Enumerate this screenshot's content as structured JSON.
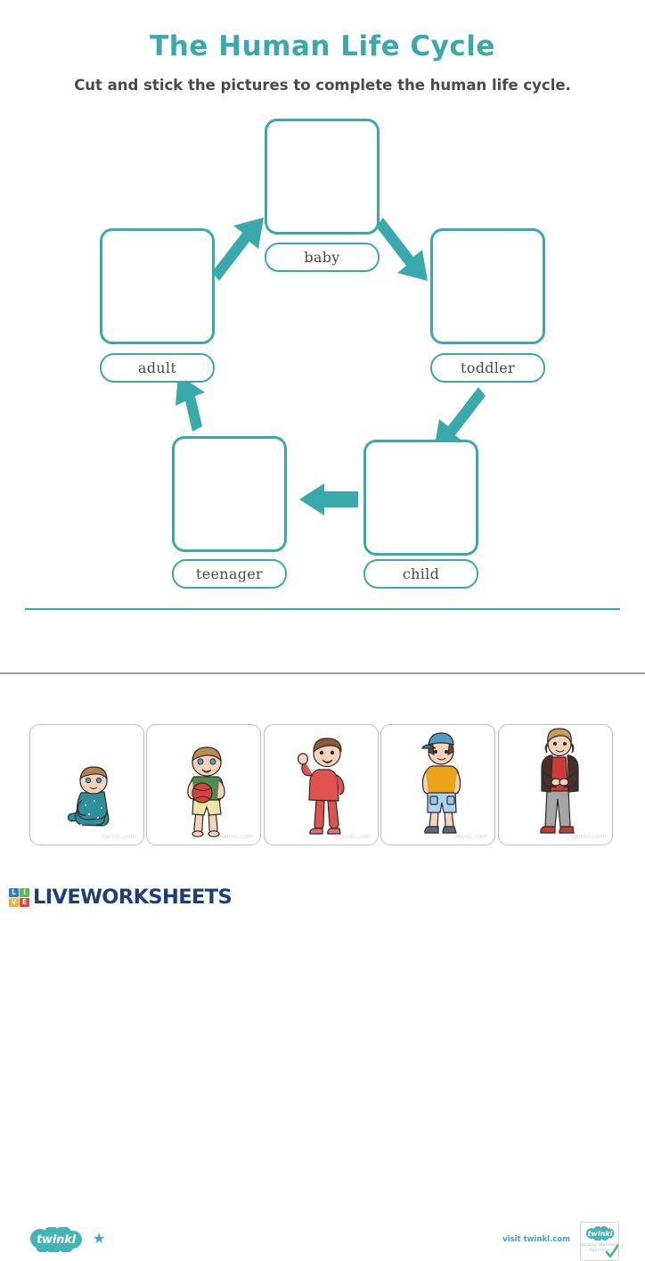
{
  "worksheet": {
    "title": "The Human Life Cycle",
    "subtitle": "Cut and stick the pictures to complete the human life cycle.",
    "title_color": "#3aa9ac",
    "accent_color": "#3aa9ac"
  },
  "cycle": {
    "stages": [
      {
        "id": "baby",
        "label": "baby",
        "box_placeholder": ""
      },
      {
        "id": "toddler",
        "label": "toddler",
        "box_placeholder": ""
      },
      {
        "id": "child",
        "label": "child",
        "box_placeholder": ""
      },
      {
        "id": "teenager",
        "label": "teenager",
        "box_placeholder": ""
      },
      {
        "id": "adult",
        "label": "adult",
        "box_placeholder": ""
      }
    ],
    "arrow_color": "#3aa9ac",
    "arrows": [
      {
        "from": "adult",
        "to": "baby",
        "direction": "up-right"
      },
      {
        "from": "baby",
        "to": "toddler",
        "direction": "down-right"
      },
      {
        "from": "toddler",
        "to": "child",
        "direction": "down-left"
      },
      {
        "from": "child",
        "to": "teenager",
        "direction": "left"
      },
      {
        "from": "teenager",
        "to": "adult",
        "direction": "up-left"
      }
    ]
  },
  "footer": {
    "logo_text": "twinkl",
    "star_glyph": "★",
    "visit_text": "visit twinkl.com",
    "badge": {
      "logo_text": "twinkl",
      "line1": "Quality Standard",
      "line2": "Approved",
      "check_color": "#3cb878"
    }
  },
  "cutouts": {
    "watermark": "twinkl.com",
    "cards": [
      {
        "name": "baby-sitting",
        "watermark": "twinkl.com"
      },
      {
        "name": "toddler-with-ball",
        "watermark": "twinkl.com"
      },
      {
        "name": "child-waving",
        "watermark": "twinkl.com"
      },
      {
        "name": "teenager-with-cap",
        "watermark": "twinkl.com"
      },
      {
        "name": "adult-standing",
        "watermark": "twinkl.com"
      }
    ]
  },
  "branding": {
    "wordmark": "LIVEWORKSHEETS",
    "wordmark_color": "#1d3f73",
    "tiles": [
      {
        "letter": "L",
        "color": "#2f79c0"
      },
      {
        "letter": "I",
        "color": "#5fb84f"
      },
      {
        "letter": "V",
        "color": "#f2b233"
      },
      {
        "letter": "E",
        "color": "#e0443e"
      }
    ]
  }
}
